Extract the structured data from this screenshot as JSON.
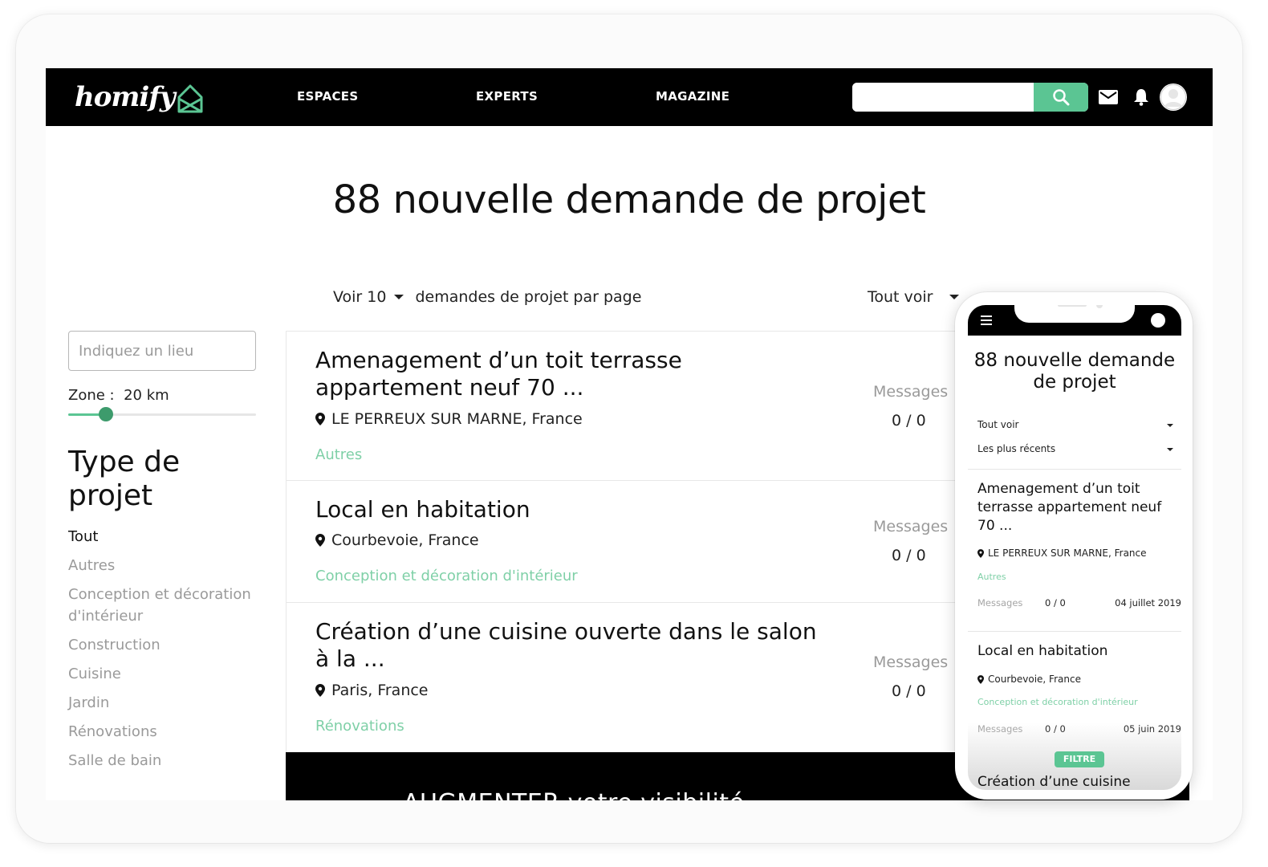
{
  "nav": {
    "logo_text": "homify",
    "links": [
      "ESPACES",
      "EXPERTS",
      "MAGAZINE"
    ],
    "search_placeholder": "",
    "accent_color": "#5bc593"
  },
  "page": {
    "title": "88 nouvelle demande de projet",
    "per_page_select": "Voir 10",
    "per_page_label": "demandes de projet par page",
    "filter_select": "Tout voir"
  },
  "sidebar": {
    "location_placeholder": "Indiquez un lieu",
    "zone_label": "Zone :",
    "zone_value": "20 km",
    "zone_fraction": 0.2,
    "type_title": "Type de projet",
    "types": [
      "Tout",
      "Autres",
      "Conception et décoration d'intérieur",
      "Construction",
      "Cuisine",
      "Jardin",
      "Rénovations",
      "Salle de bain"
    ],
    "active_type": "Tout"
  },
  "projects": [
    {
      "title": "Amenagement d’un toit terrasse appartement neuf 70 ...",
      "location": "LE PERREUX SUR MARNE, France",
      "category": "Autres",
      "messages_label": "Messages",
      "messages": "0 / 0"
    },
    {
      "title": "Local en habitation",
      "location": "Courbevoie, France",
      "category": "Conception et décoration d'intérieur",
      "messages_label": "Messages",
      "messages": "0 / 0"
    },
    {
      "title": "Création d’une cuisine ouverte dans le salon à la ...",
      "location": "Paris, France",
      "category": "Rénovations",
      "messages_label": "Messages",
      "messages": "0 / 0"
    }
  ],
  "promo": {
    "text": "AUGMENTER votre visibilité"
  },
  "mobile": {
    "title": "88 nouvelle demande de projet",
    "filter_select": "Tout voir",
    "sort_select": "Les plus récents",
    "cards": [
      {
        "title": "Amenagement d’un toit terrasse appartement neuf 70 ...",
        "location": "LE PERREUX SUR MARNE, France",
        "category": "Autres",
        "messages_label": "Messages",
        "messages": "0 / 0",
        "date": "04 juillet 2019"
      },
      {
        "title": "Local en habitation",
        "location": "Courbevoie, France",
        "category": "Conception et décoration d'intérieur",
        "messages_label": "Messages",
        "messages": "0 / 0",
        "date": "05 juin 2019"
      }
    ],
    "filter_button": "FILTRE",
    "peek_title": "Création d’une cuisine"
  }
}
